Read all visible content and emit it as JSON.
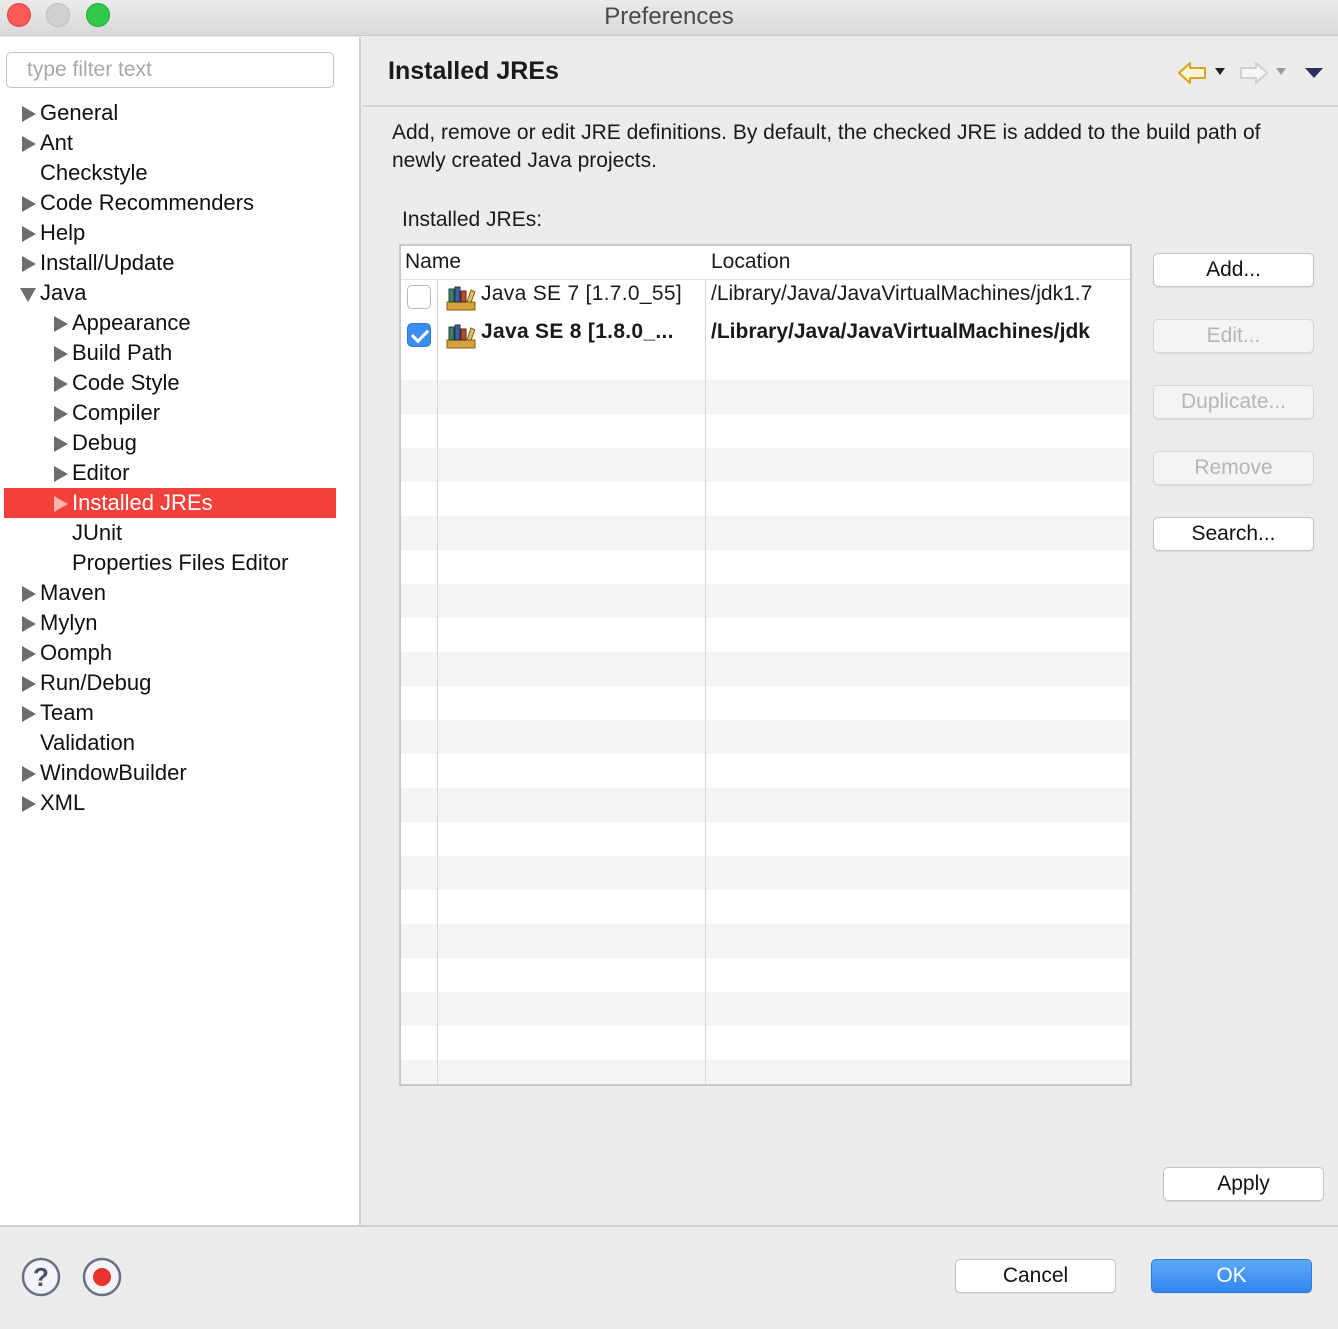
{
  "window": {
    "title": "Preferences"
  },
  "filter": {
    "placeholder": "type filter text"
  },
  "tree": [
    {
      "label": "General",
      "level": 0,
      "arrow": "collapsed"
    },
    {
      "label": "Ant",
      "level": 0,
      "arrow": "collapsed"
    },
    {
      "label": "Checkstyle",
      "level": 0,
      "arrow": "none"
    },
    {
      "label": "Code Recommenders",
      "level": 0,
      "arrow": "collapsed"
    },
    {
      "label": "Help",
      "level": 0,
      "arrow": "collapsed"
    },
    {
      "label": "Install/Update",
      "level": 0,
      "arrow": "collapsed"
    },
    {
      "label": "Java",
      "level": 0,
      "arrow": "expanded"
    },
    {
      "label": "Appearance",
      "level": 1,
      "arrow": "collapsed"
    },
    {
      "label": "Build Path",
      "level": 1,
      "arrow": "collapsed"
    },
    {
      "label": "Code Style",
      "level": 1,
      "arrow": "collapsed"
    },
    {
      "label": "Compiler",
      "level": 1,
      "arrow": "collapsed"
    },
    {
      "label": "Debug",
      "level": 1,
      "arrow": "collapsed"
    },
    {
      "label": "Editor",
      "level": 1,
      "arrow": "collapsed"
    },
    {
      "label": "Installed JREs",
      "level": 1,
      "arrow": "collapsed",
      "selected": true
    },
    {
      "label": "JUnit",
      "level": 1,
      "arrow": "none"
    },
    {
      "label": "Properties Files Editor",
      "level": 1,
      "arrow": "none"
    },
    {
      "label": "Maven",
      "level": 0,
      "arrow": "collapsed"
    },
    {
      "label": "Mylyn",
      "level": 0,
      "arrow": "collapsed"
    },
    {
      "label": "Oomph",
      "level": 0,
      "arrow": "collapsed"
    },
    {
      "label": "Run/Debug",
      "level": 0,
      "arrow": "collapsed"
    },
    {
      "label": "Team",
      "level": 0,
      "arrow": "collapsed"
    },
    {
      "label": "Validation",
      "level": 0,
      "arrow": "none"
    },
    {
      "label": "WindowBuilder",
      "level": 0,
      "arrow": "collapsed"
    },
    {
      "label": "XML",
      "level": 0,
      "arrow": "collapsed"
    }
  ],
  "page": {
    "title": "Installed JREs",
    "description": "Add, remove or edit JRE definitions. By default, the checked JRE is added to the build path of newly created Java projects.",
    "table_label": "Installed JREs:"
  },
  "table": {
    "columns": [
      "Name",
      "Location"
    ],
    "rows": [
      {
        "checked": false,
        "name": "Java SE 7 [1.7.0_55]",
        "location": "/Library/Java/JavaVirtualMachines/jdk1.7",
        "bold": false
      },
      {
        "checked": true,
        "name": "Java SE 8 [1.8.0_...",
        "location": "/Library/Java/JavaVirtualMachines/jdk",
        "bold": true
      }
    ]
  },
  "buttons": {
    "add": "Add...",
    "edit": "Edit...",
    "duplicate": "Duplicate...",
    "remove": "Remove",
    "search": "Search...",
    "apply": "Apply",
    "cancel": "Cancel",
    "ok": "OK"
  },
  "colors": {
    "selection": "#f2413a",
    "primary_button": "#2f88ee",
    "checkbox_on": "#3b8ef0"
  }
}
